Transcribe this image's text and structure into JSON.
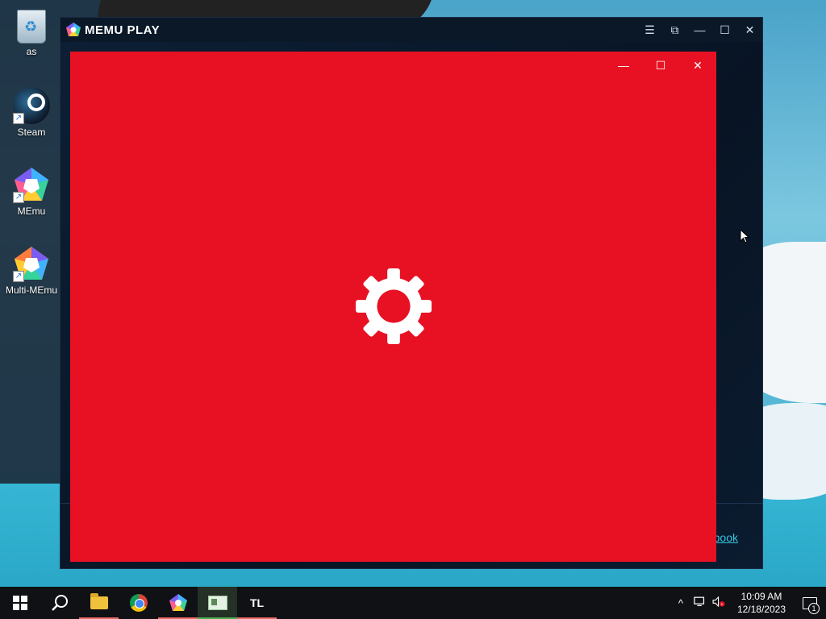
{
  "desktop": {
    "icons": [
      {
        "label": "as",
        "icon": "recycle-bin-icon"
      },
      {
        "label": "Steam",
        "icon": "steam-icon"
      },
      {
        "label": "MEmu",
        "icon": "memu-icon"
      },
      {
        "label": "Multi-MEmu",
        "icon": "multi-memu-icon"
      }
    ]
  },
  "memu_window": {
    "title": "MEMU PLAY",
    "controls": {
      "menu": "☰",
      "screen": "⧉",
      "minimize": "—",
      "maximize": "☐",
      "close": "✕"
    },
    "footer_link": "book"
  },
  "app_window": {
    "background": "#e81123",
    "controls": {
      "minimize": "—",
      "maximize": "☐",
      "close": "✕"
    },
    "loading_icon": "gear-icon"
  },
  "taskbar": {
    "apps": [
      "start-icon",
      "search-icon",
      "file-explorer-icon",
      "chrome-icon",
      "memu-icon",
      "app-icon",
      "tl-icon"
    ],
    "tl_label": "TL",
    "tray": {
      "chevron": "^",
      "time": "10:09 AM",
      "date": "12/18/2023",
      "notifications": "1"
    }
  }
}
